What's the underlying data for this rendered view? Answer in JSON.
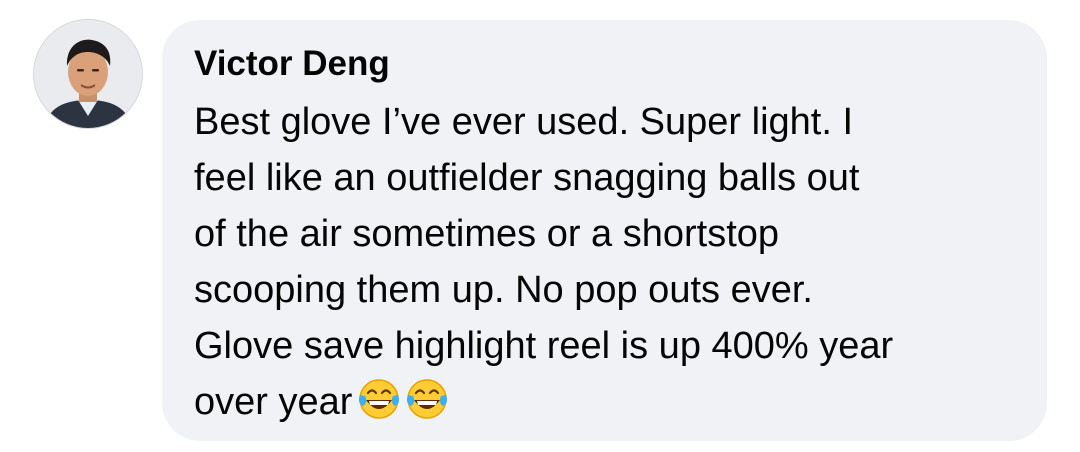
{
  "comment": {
    "author": "Victor Deng",
    "lines": [
      "Best glove I’ve ever used. Super light. I",
      "feel like an outfielder snagging balls out",
      "of the air sometimes or a shortstop",
      "scooping them up. No pop outs ever.",
      "Glove save highlight reel is up 400% year",
      "over year"
    ],
    "emojis": [
      "face-with-tears-of-joy",
      "face-with-tears-of-joy"
    ]
  },
  "colors": {
    "bubble": "#f0f2f5",
    "text": "#050505",
    "page": "#ffffff"
  }
}
